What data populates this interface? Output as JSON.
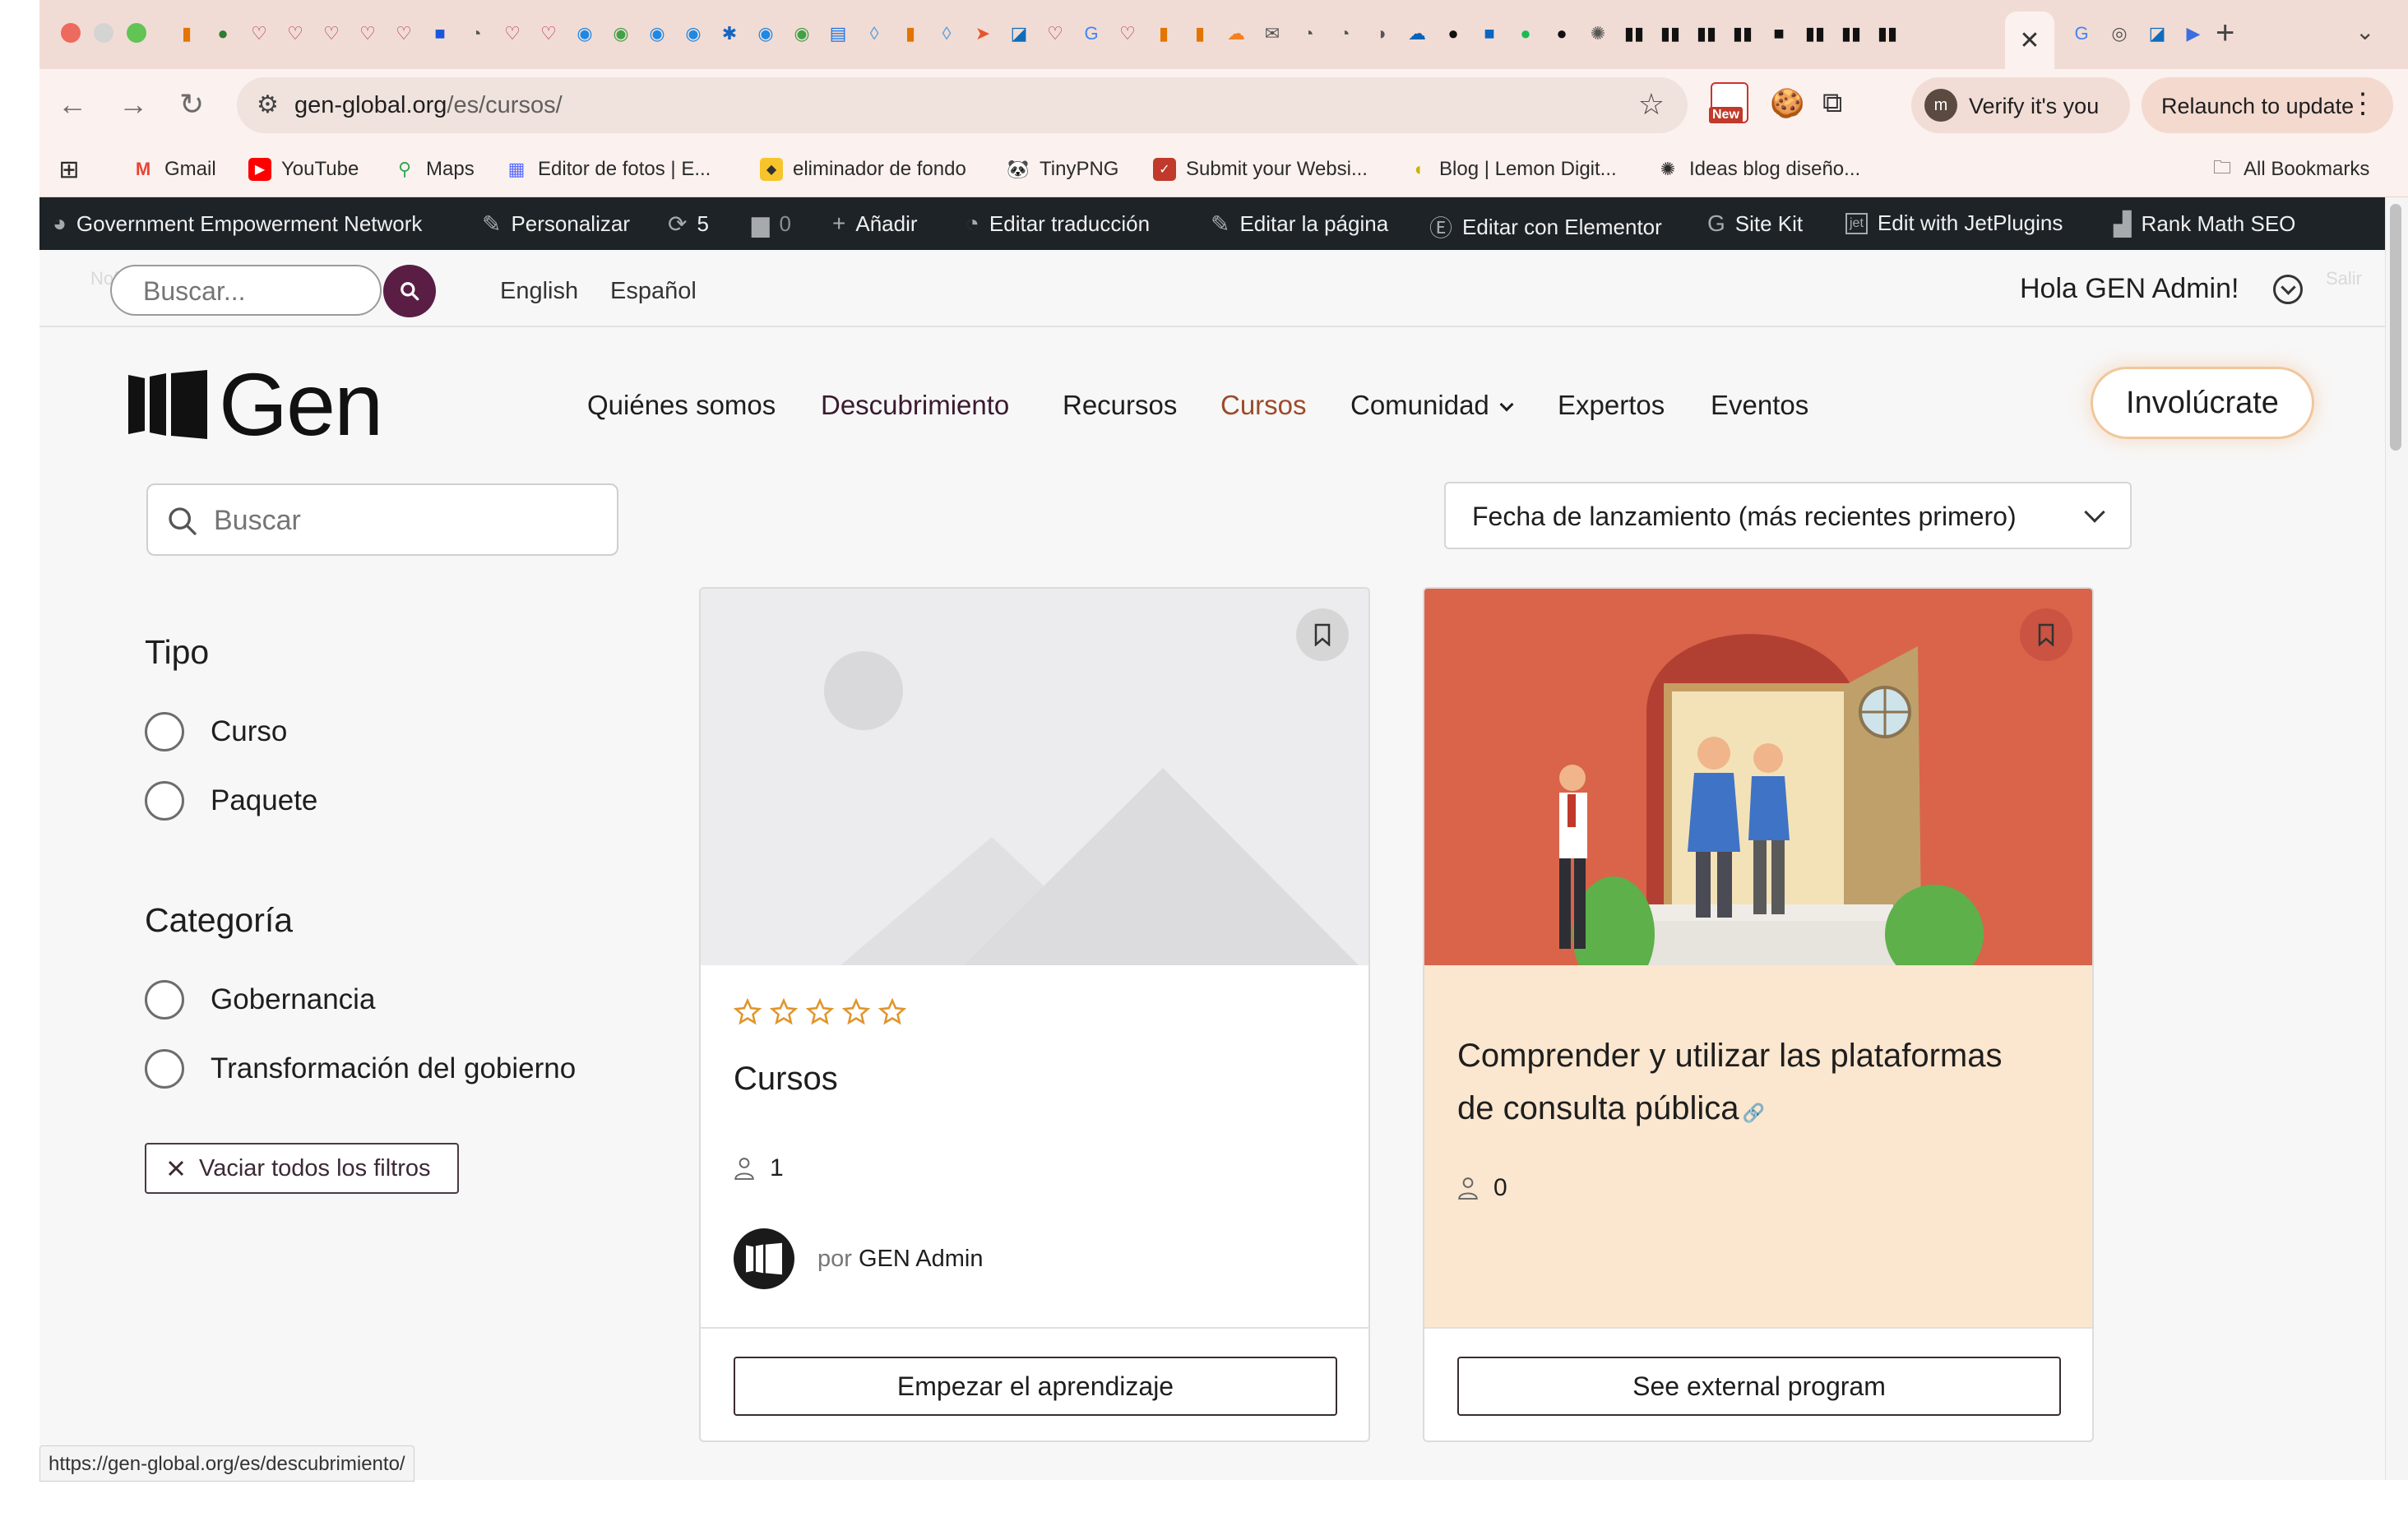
{
  "browser": {
    "url_host": "gen-global.org",
    "url_path": "/es/cursos/",
    "verify_label": "Verify it's you",
    "verify_avatar": "m",
    "relaunch_label": "Relaunch to update",
    "new_badge": "New",
    "bookmarks": [
      {
        "label": "Gmail",
        "icon": "gmail-icon"
      },
      {
        "label": "YouTube",
        "icon": "youtube-icon"
      },
      {
        "label": "Maps",
        "icon": "maps-icon"
      },
      {
        "label": "Editor de fotos | E...",
        "icon": "photo-editor-icon"
      },
      {
        "label": "eliminador de fondo",
        "icon": "background-remover-icon"
      },
      {
        "label": "TinyPNG",
        "icon": "tinypng-icon"
      },
      {
        "label": "Submit your Websi...",
        "icon": "submit-site-icon"
      },
      {
        "label": "Blog | Lemon Digit...",
        "icon": "lemon-icon"
      },
      {
        "label": "Ideas blog diseño...",
        "icon": "openai-icon"
      }
    ],
    "all_bookmarks": "All Bookmarks"
  },
  "wp_admin_bar": {
    "site_name": "Government Empowerment Network",
    "customize": "Personalizar",
    "updates_count": "5",
    "comments_count": "0",
    "add_new": "Añadir",
    "edit_translation": "Editar traducción",
    "edit_page": "Editar la página",
    "edit_elementor": "Editar con Elementor",
    "site_kit": "Site Kit",
    "jetplugins": "Edit with JetPlugins",
    "rank_math": "Rank Math SEO"
  },
  "site_header": {
    "search_placeholder": "Buscar...",
    "lang_en": "English",
    "lang_es": "Español",
    "greeting": "Hola GEN Admin!",
    "ghost_left": "Nofo... WP Rocket",
    "ghost_right": "Salir",
    "logo_text": "Gen",
    "nav": [
      "Quiénes somos",
      "Descubrimiento",
      "Recursos",
      "Cursos",
      "Comunidad",
      "Expertos",
      "Eventos"
    ],
    "cta": "Involúcrate"
  },
  "filters": {
    "search_placeholder": "Buscar",
    "sort_value": "Fecha de lanzamiento (más recientes primero)",
    "tipo_title": "Tipo",
    "tipo_options": [
      "Curso",
      "Paquete"
    ],
    "categoria_title": "Categoría",
    "categoria_options": [
      "Gobernancia",
      "Transformación del gobierno"
    ],
    "clear_label": "Vaciar todos los filtros"
  },
  "cards": [
    {
      "title": "Cursos",
      "rating": 0,
      "students": "1",
      "by_prefix": "por",
      "author": "GEN Admin",
      "cta": "Empezar el aprendizaje"
    },
    {
      "title_line1": "Comprender y utilizar las plataformas",
      "title_line2": "de consulta pública",
      "students": "0",
      "cta": "See external program"
    }
  ],
  "status_bar_url": "https://gen-global.org/es/descubrimiento/",
  "colors": {
    "brand_purple": "#5a1e45",
    "active_nav": "#9c4a2a",
    "star": "#e0952b",
    "card_peach": "#fbe6cf",
    "illustration_bg": "#d9644a"
  }
}
